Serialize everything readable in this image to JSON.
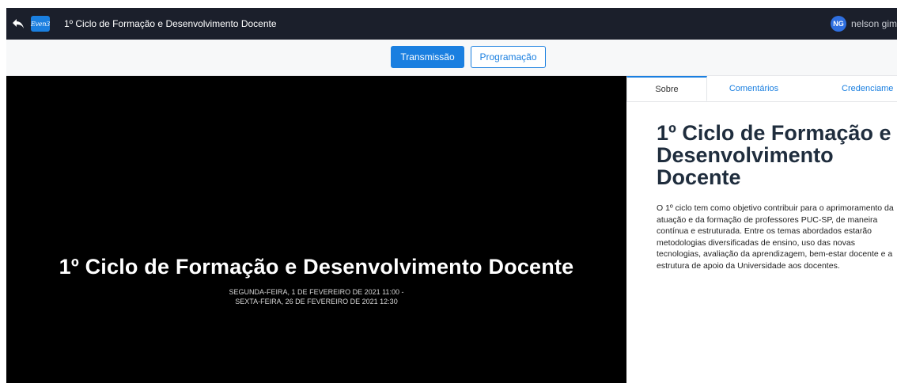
{
  "topbar": {
    "logo_text": "Even3",
    "title": "1º Ciclo de Formação e Desenvolvimento Docente",
    "user_initials": "NG",
    "user_name": "nelson gim"
  },
  "nav": {
    "transmissao_label": "Transmissão",
    "programacao_label": "Programação"
  },
  "video": {
    "title": "1º Ciclo de Formação e Desenvolvimento Docente",
    "date_line1": "SEGUNDA-FEIRA, 1 DE FEVEREIRO DE 2021 11:00 -",
    "date_line2": "SEXTA-FEIRA, 26 DE FEVEREIRO DE 2021 12:30"
  },
  "panel": {
    "tabs": [
      "Sobre",
      "Comentários",
      "Credenciame"
    ],
    "about_title": "1º Ciclo de Formação e Desenvolvimento Docente",
    "about_text": "O 1º ciclo tem como objetivo contribuir para o aprimoramento da atuação e da formação de professores PUC-SP, de maneira contínua e estruturada. Entre os temas abordados estarão metodologias diversificadas de ensino, uso das novas tecnologias, avaliação da aprendizagem, bem-estar docente e a estrutura de apoio da Universidade aos docentes."
  },
  "colors": {
    "accent": "#1a7fe0",
    "topbar_bg": "#1b1f2b",
    "video_bg": "#000000"
  },
  "icons": {
    "back": "back-arrow-icon"
  }
}
